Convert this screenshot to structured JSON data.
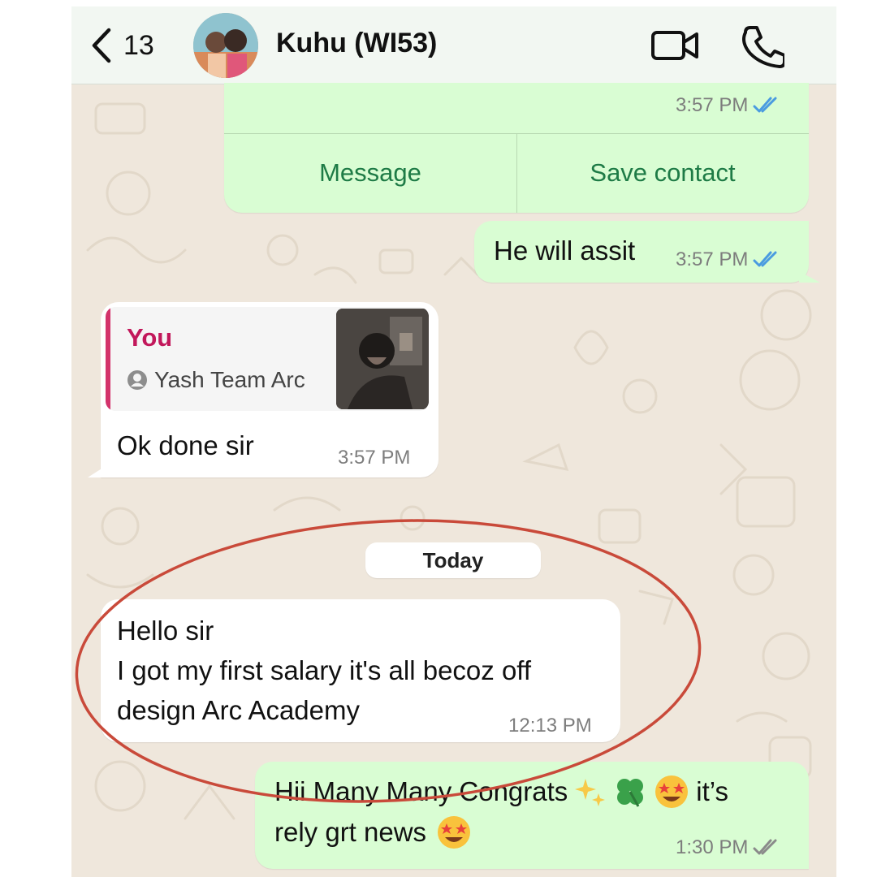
{
  "header": {
    "back_count": "13",
    "contact_name": "Kuhu (WI53)"
  },
  "messages": {
    "card_time": "3:57 PM",
    "card_message_label": "Message",
    "card_save_label": "Save contact",
    "assist_text": "He will assit",
    "assist_time": "3:57 PM",
    "reply_author": "You",
    "reply_contact": "Yash Team Arc",
    "ok_text": "Ok done sir",
    "ok_time": "3:57 PM",
    "date_divider": "Today",
    "salary_line1": "Hello sir",
    "salary_line2": "I got my first salary it's all becoz off",
    "salary_line3": "design Arc Academy",
    "salary_time": "12:13 PM",
    "congrats_line1_a": "Hii Many Many Congrats",
    "congrats_line1_b": "it’s",
    "congrats_line2": "rely grt news",
    "congrats_time": "1:30 PM"
  },
  "colors": {
    "outgoing_bubble": "#d9fdd3",
    "incoming_bubble": "#ffffff",
    "read_ticks": "#53bdeb",
    "delivered_ticks": "#8a8a8a",
    "reply_accent": "#c2185b",
    "circle_annotation": "#c94a3a"
  },
  "icons": [
    "chevron-left-icon",
    "video-camera-icon",
    "phone-icon",
    "double-check-icon",
    "person-icon",
    "sparkles-emoji",
    "four-leaf-clover-emoji",
    "star-struck-emoji"
  ]
}
